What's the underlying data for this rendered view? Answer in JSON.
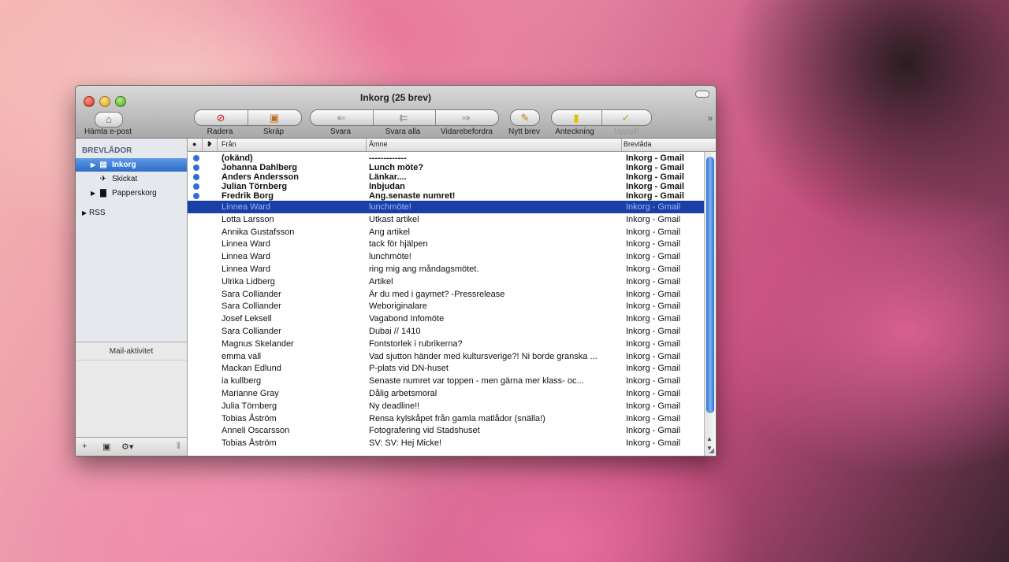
{
  "window": {
    "title": "Inkorg (25 brev)"
  },
  "toolbar": {
    "fetch_label": "Hämta e-post",
    "delete_label": "Radera",
    "junk_label": "Skräp",
    "reply_label": "Svara",
    "reply_all_label": "Svara alla",
    "forward_label": "Vidarebefordra",
    "new_label": "Nytt brev",
    "note_label": "Anteckning",
    "todo_label": "Uppgift"
  },
  "sidebar": {
    "heading": "BREVLÅDOR",
    "items": [
      {
        "label": "Inkorg",
        "icon": "inbox-icon"
      },
      {
        "label": "Skickat",
        "icon": "sent-icon"
      },
      {
        "label": "Papperskorg",
        "icon": "trash-icon"
      },
      {
        "label": "RSS",
        "icon": "rss-disclosure"
      }
    ],
    "activity_label": "Mail-aktivitet"
  },
  "columns": {
    "from": "Från",
    "subject": "Ämne",
    "mailbox": "Brevlåda"
  },
  "messages": [
    {
      "from": "(okänd)",
      "subject": "-------------",
      "mailbox": "Inkorg - Gmail"
    },
    {
      "from": "Johanna Dahlberg",
      "subject": "Lunch möte?",
      "mailbox": "Inkorg - Gmail"
    },
    {
      "from": "Anders Andersson",
      "subject": "Länkar....",
      "mailbox": "Inkorg - Gmail"
    },
    {
      "from": "Julian Törnberg",
      "subject": "Inbjudan",
      "mailbox": "Inkorg - Gmail"
    },
    {
      "from": "Fredrik Borg",
      "subject": "Ang.senaste numret!",
      "mailbox": "Inkorg - Gmail"
    },
    {
      "from": "Linnea Ward",
      "subject": "lunchmöte!",
      "mailbox": "Inkorg - Gmail"
    },
    {
      "from": "Lotta Larsson",
      "subject": "Utkast artikel",
      "mailbox": "Inkorg - Gmail"
    },
    {
      "from": "Annika Gustafsson",
      "subject": "Ang artikel",
      "mailbox": "Inkorg - Gmail"
    },
    {
      "from": "Linnea Ward",
      "subject": "tack för hjälpen",
      "mailbox": "Inkorg - Gmail"
    },
    {
      "from": "Linnea Ward",
      "subject": "lunchmöte!",
      "mailbox": "Inkorg - Gmail"
    },
    {
      "from": "Linnea Ward",
      "subject": "ring mig ang måndagsmötet.",
      "mailbox": "Inkorg - Gmail"
    },
    {
      "from": "Ulrika Lidberg",
      "subject": "Artikel",
      "mailbox": "Inkorg - Gmail"
    },
    {
      "from": "Sara Colliander",
      "subject": "Är du med i gaymet? -Pressrelease",
      "mailbox": "Inkorg - Gmail"
    },
    {
      "from": "Sara Colliander",
      "subject": "Weboriginalare",
      "mailbox": "Inkorg - Gmail"
    },
    {
      "from": "Josef Leksell",
      "subject": "Vagabond Infomöte",
      "mailbox": "Inkorg - Gmail"
    },
    {
      "from": "Sara Colliander",
      "subject": "Dubai // 1410",
      "mailbox": "Inkorg - Gmail"
    },
    {
      "from": "Magnus Skelander",
      "subject": "Fontstorlek i rubrikerna?",
      "mailbox": "Inkorg - Gmail"
    },
    {
      "from": "emma vall",
      "subject": "Vad sjutton händer med kultursverige?! Ni borde granska ...",
      "mailbox": "Inkorg - Gmail"
    },
    {
      "from": "Mackan Edlund",
      "subject": "P-plats vid DN-huset",
      "mailbox": "Inkorg - Gmail"
    },
    {
      "from": "ia kullberg",
      "subject": "Senaste numret var toppen - men gärna mer klass- oc...",
      "mailbox": "Inkorg - Gmail"
    },
    {
      "from": "Marianne Gray",
      "subject": "Dålig arbetsmoral",
      "mailbox": "Inkorg - Gmail"
    },
    {
      "from": "Julia Törnberg",
      "subject": "Ny deadline!!",
      "mailbox": "Inkorg - Gmail"
    },
    {
      "from": "Tobias Åström",
      "subject": "Rensa kylskåpet från gamla matlådor (snälla!)",
      "mailbox": "Inkorg - Gmail"
    },
    {
      "from": "Anneli Oscarsson",
      "subject": "Fotografering vid Stadshuset",
      "mailbox": "Inkorg - Gmail"
    },
    {
      "from": "Tobias Åström",
      "subject": "SV: SV: Hej Micke!",
      "mailbox": "Inkorg - Gmail"
    }
  ]
}
